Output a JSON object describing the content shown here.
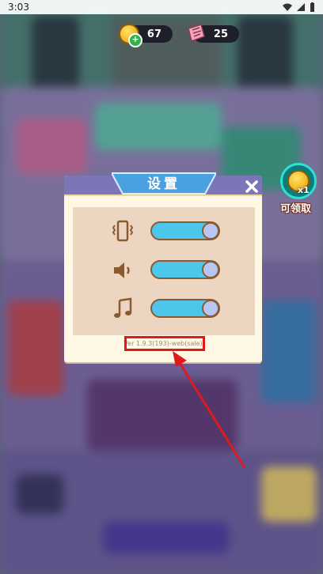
{
  "status_bar": {
    "time": "3:03",
    "icons": [
      "wifi-icon",
      "signal-icon",
      "battery-icon"
    ]
  },
  "currency": {
    "coins": "67",
    "tickets": "25",
    "coin_icon": "coin-icon",
    "ticket_icon": "ticket-icon"
  },
  "reward": {
    "count": "x1",
    "label": "可领取"
  },
  "settings": {
    "title": "设置",
    "close_icon": "close-icon",
    "rows": [
      {
        "icon": "vibration-icon",
        "enabled": true
      },
      {
        "icon": "sound-icon",
        "enabled": true
      },
      {
        "icon": "music-icon",
        "enabled": true
      }
    ],
    "version": "Ver 1.9.3(193)-web(sale)"
  },
  "colors": {
    "accent": "#7c76b8",
    "toggle_on": "#4dc6ec",
    "highlight": "#e0191b"
  }
}
